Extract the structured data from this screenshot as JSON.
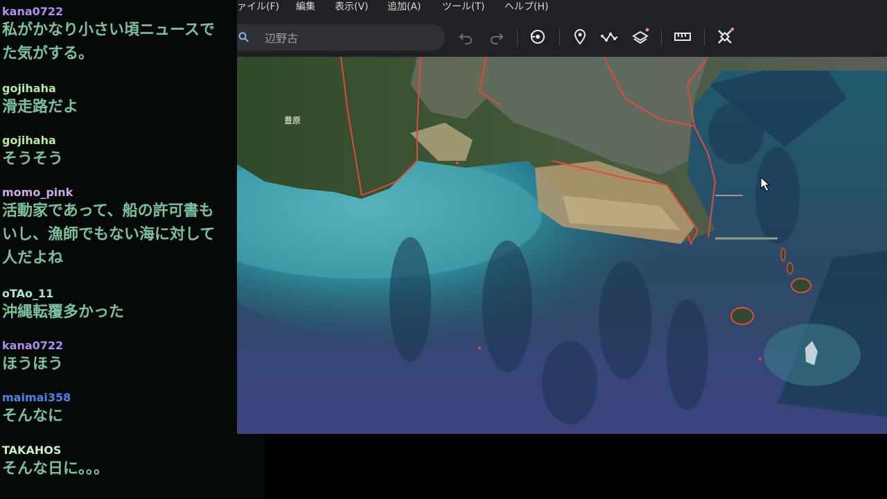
{
  "chat": {
    "messages": [
      {
        "user": "kana0722",
        "user_color": "#b58cf0",
        "text": "私がかなり小さい頃ニュースで\nた気がする。"
      },
      {
        "user": "gojihaha",
        "user_color": "#b5e8a0",
        "text": "滑走路だよ"
      },
      {
        "user": "gojihaha",
        "user_color": "#b5e8a0",
        "text": "そうそう"
      },
      {
        "user": "momo_pink",
        "user_color": "#d0a8e8",
        "text": "活動家であって、船の許可書も\nいし、漁師でもない海に対して\n人だよね"
      },
      {
        "user": "oTAo_11",
        "user_color": "#a8e8d0",
        "text": "沖縄転覆多かった"
      },
      {
        "user": "kana0722",
        "user_color": "#b58cf0",
        "text": "ほうほう"
      },
      {
        "user": "maimai358",
        "user_color": "#4a86e8",
        "text": "そんなに"
      },
      {
        "user": "TAKAHOS",
        "user_color": "#c8f0c0",
        "text": "そんな日に。。。"
      }
    ]
  },
  "app": {
    "menu": [
      "ァイル(F)",
      "編集",
      "表示(V)",
      "追加(A)",
      "ツール(T)",
      "ヘルプ(H)"
    ],
    "search": {
      "value": "",
      "placeholder": "辺野古"
    },
    "toolbar_icons": [
      "undo-icon",
      "redo-icon",
      "historical-imagery-icon",
      "placemark-icon",
      "path-icon",
      "layers-icon",
      "ruler-icon",
      "measure-tool-icon"
    ],
    "map": {
      "label_toyohara": "豊原"
    }
  },
  "colors": {
    "chat_text": "#7cc2a0",
    "chat_bg": "#050a08",
    "app_bg": "#202124",
    "accent_dot": "#f28b82",
    "boundary_line": "#e24a3a"
  }
}
